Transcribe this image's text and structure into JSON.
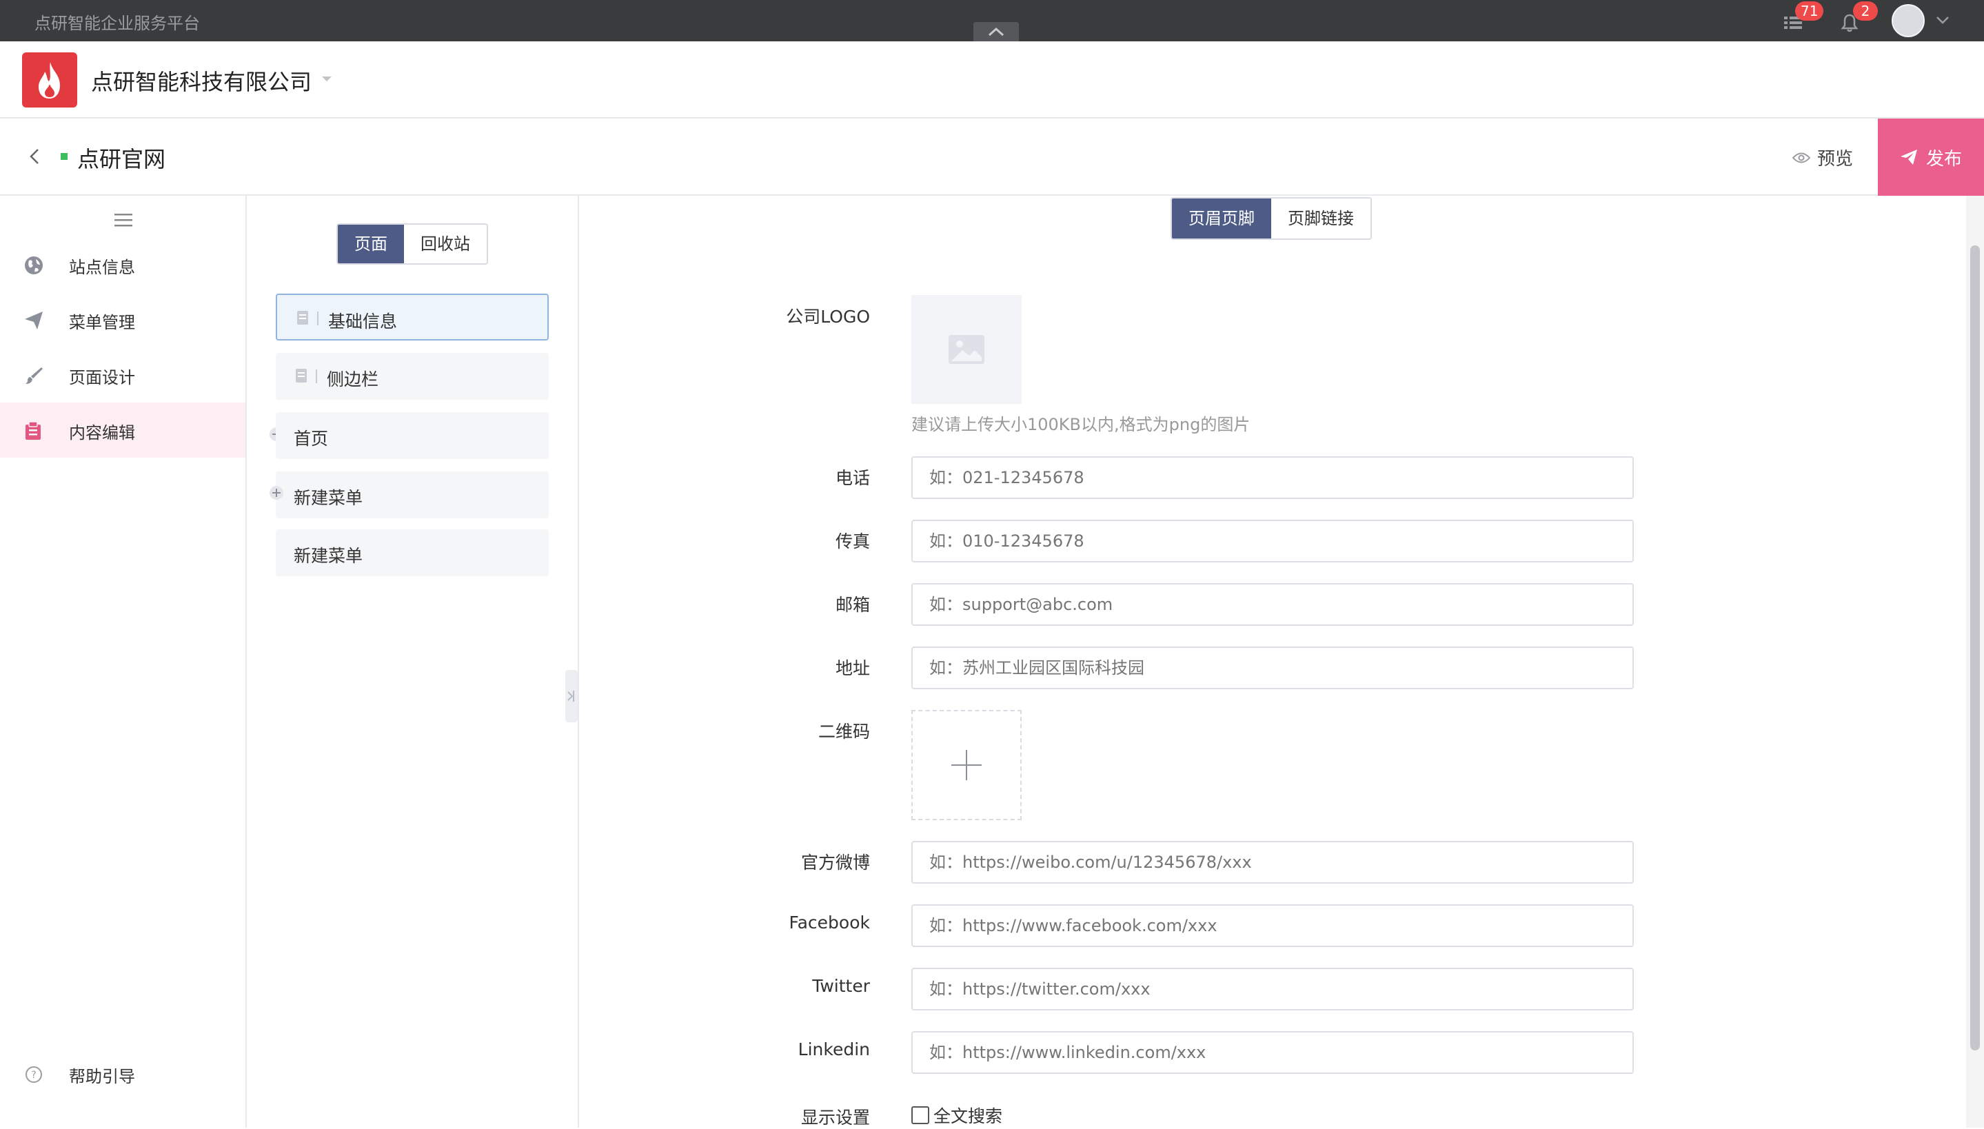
{
  "topbar": {
    "brand": "点研智能企业服务平台",
    "tasks_badge": "71",
    "notify_badge": "2"
  },
  "company": {
    "name": "点研智能科技有限公司"
  },
  "site": {
    "name": "点研官网",
    "preview_label": "预览",
    "publish_label": "发布"
  },
  "sidebar": {
    "items": [
      {
        "label": "站点信息",
        "icon": "globe-icon"
      },
      {
        "label": "菜单管理",
        "icon": "paper-plane-icon"
      },
      {
        "label": "页面设计",
        "icon": "brush-icon"
      },
      {
        "label": "内容编辑",
        "icon": "content-edit-icon",
        "active": true
      }
    ],
    "help_label": "帮助引导"
  },
  "tree": {
    "seg_pages": "页面",
    "seg_recycle": "回收站",
    "items": [
      "基础信息",
      "侧边栏",
      "首页",
      "新建菜单",
      "新建菜单"
    ]
  },
  "tabs": {
    "header_footer": "页眉页脚",
    "footer_links": "页脚链接"
  },
  "form": {
    "logo_label": "公司LOGO",
    "logo_hint": "建议请上传大小100KB以内,格式为png的图片",
    "phone_label": "电话",
    "phone_ph": "如：021-12345678",
    "fax_label": "传真",
    "fax_ph": "如：010-12345678",
    "email_label": "邮箱",
    "email_ph": "如：support@abc.com",
    "address_label": "地址",
    "address_ph": "如：苏州工业园区国际科技园",
    "qr_label": "二维码",
    "weibo_label": "官方微博",
    "weibo_ph": "如：https://weibo.com/u/12345678/xxx",
    "facebook_label": "Facebook",
    "facebook_ph": "如：https://www.facebook.com/xxx",
    "twitter_label": "Twitter",
    "twitter_ph": "如：https://twitter.com/xxx",
    "linkedin_label": "Linkedin",
    "linkedin_ph": "如：https://www.linkedin.com/xxx",
    "display_label": "显示设置",
    "fulltext_label": "全文搜索"
  },
  "colors": {
    "accent": "#4e5b86",
    "publish": "#ea5f8d",
    "brand_red": "#e33a3f",
    "topbar": "#3a3b3d"
  }
}
